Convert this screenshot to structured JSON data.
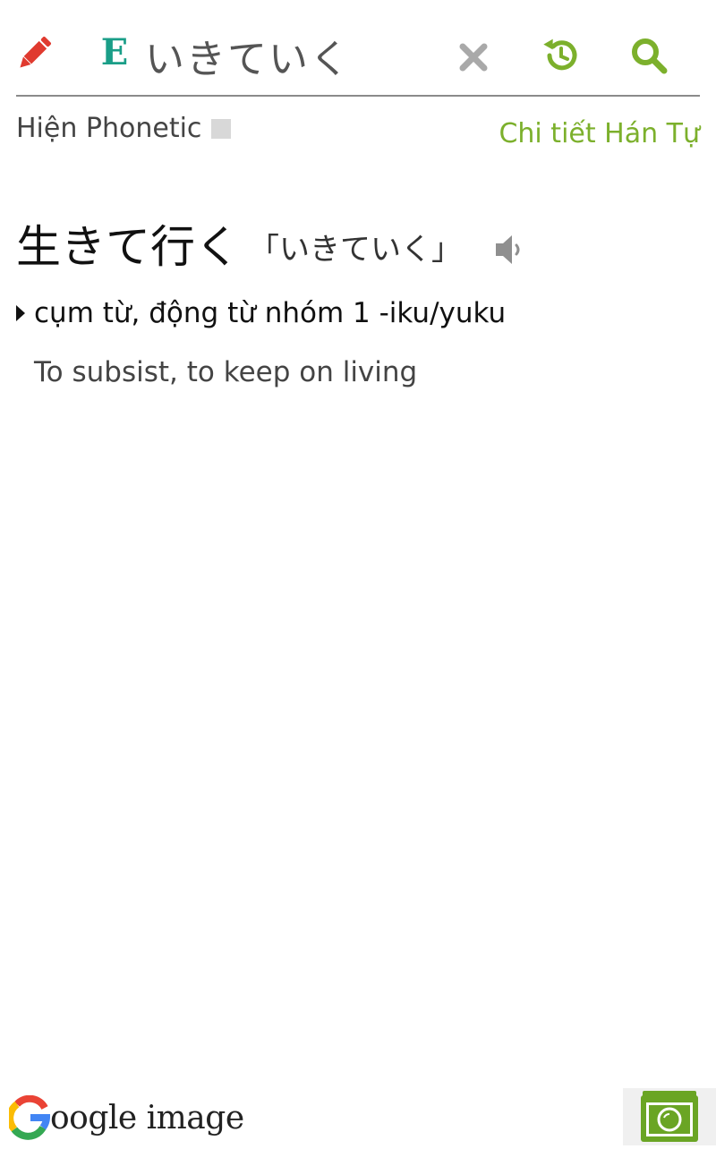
{
  "search": {
    "mode_label": "E",
    "query": "いきていく"
  },
  "options": {
    "phonetic_label": "Hiện Phonetic",
    "kanji_detail_link": "Chi tiết Hán Tự"
  },
  "entry": {
    "word": "生きて行く",
    "reading": "「いきていく」",
    "part_of_speech": "cụm từ, động từ nhóm 1 -iku/yuku",
    "meaning": "To subsist, to keep on living"
  },
  "footer": {
    "google_image_label": "oogle image"
  },
  "colors": {
    "accent_green": "#7cb02c",
    "pencil_red": "#e03a2f",
    "mode_teal": "#1a9e88"
  }
}
